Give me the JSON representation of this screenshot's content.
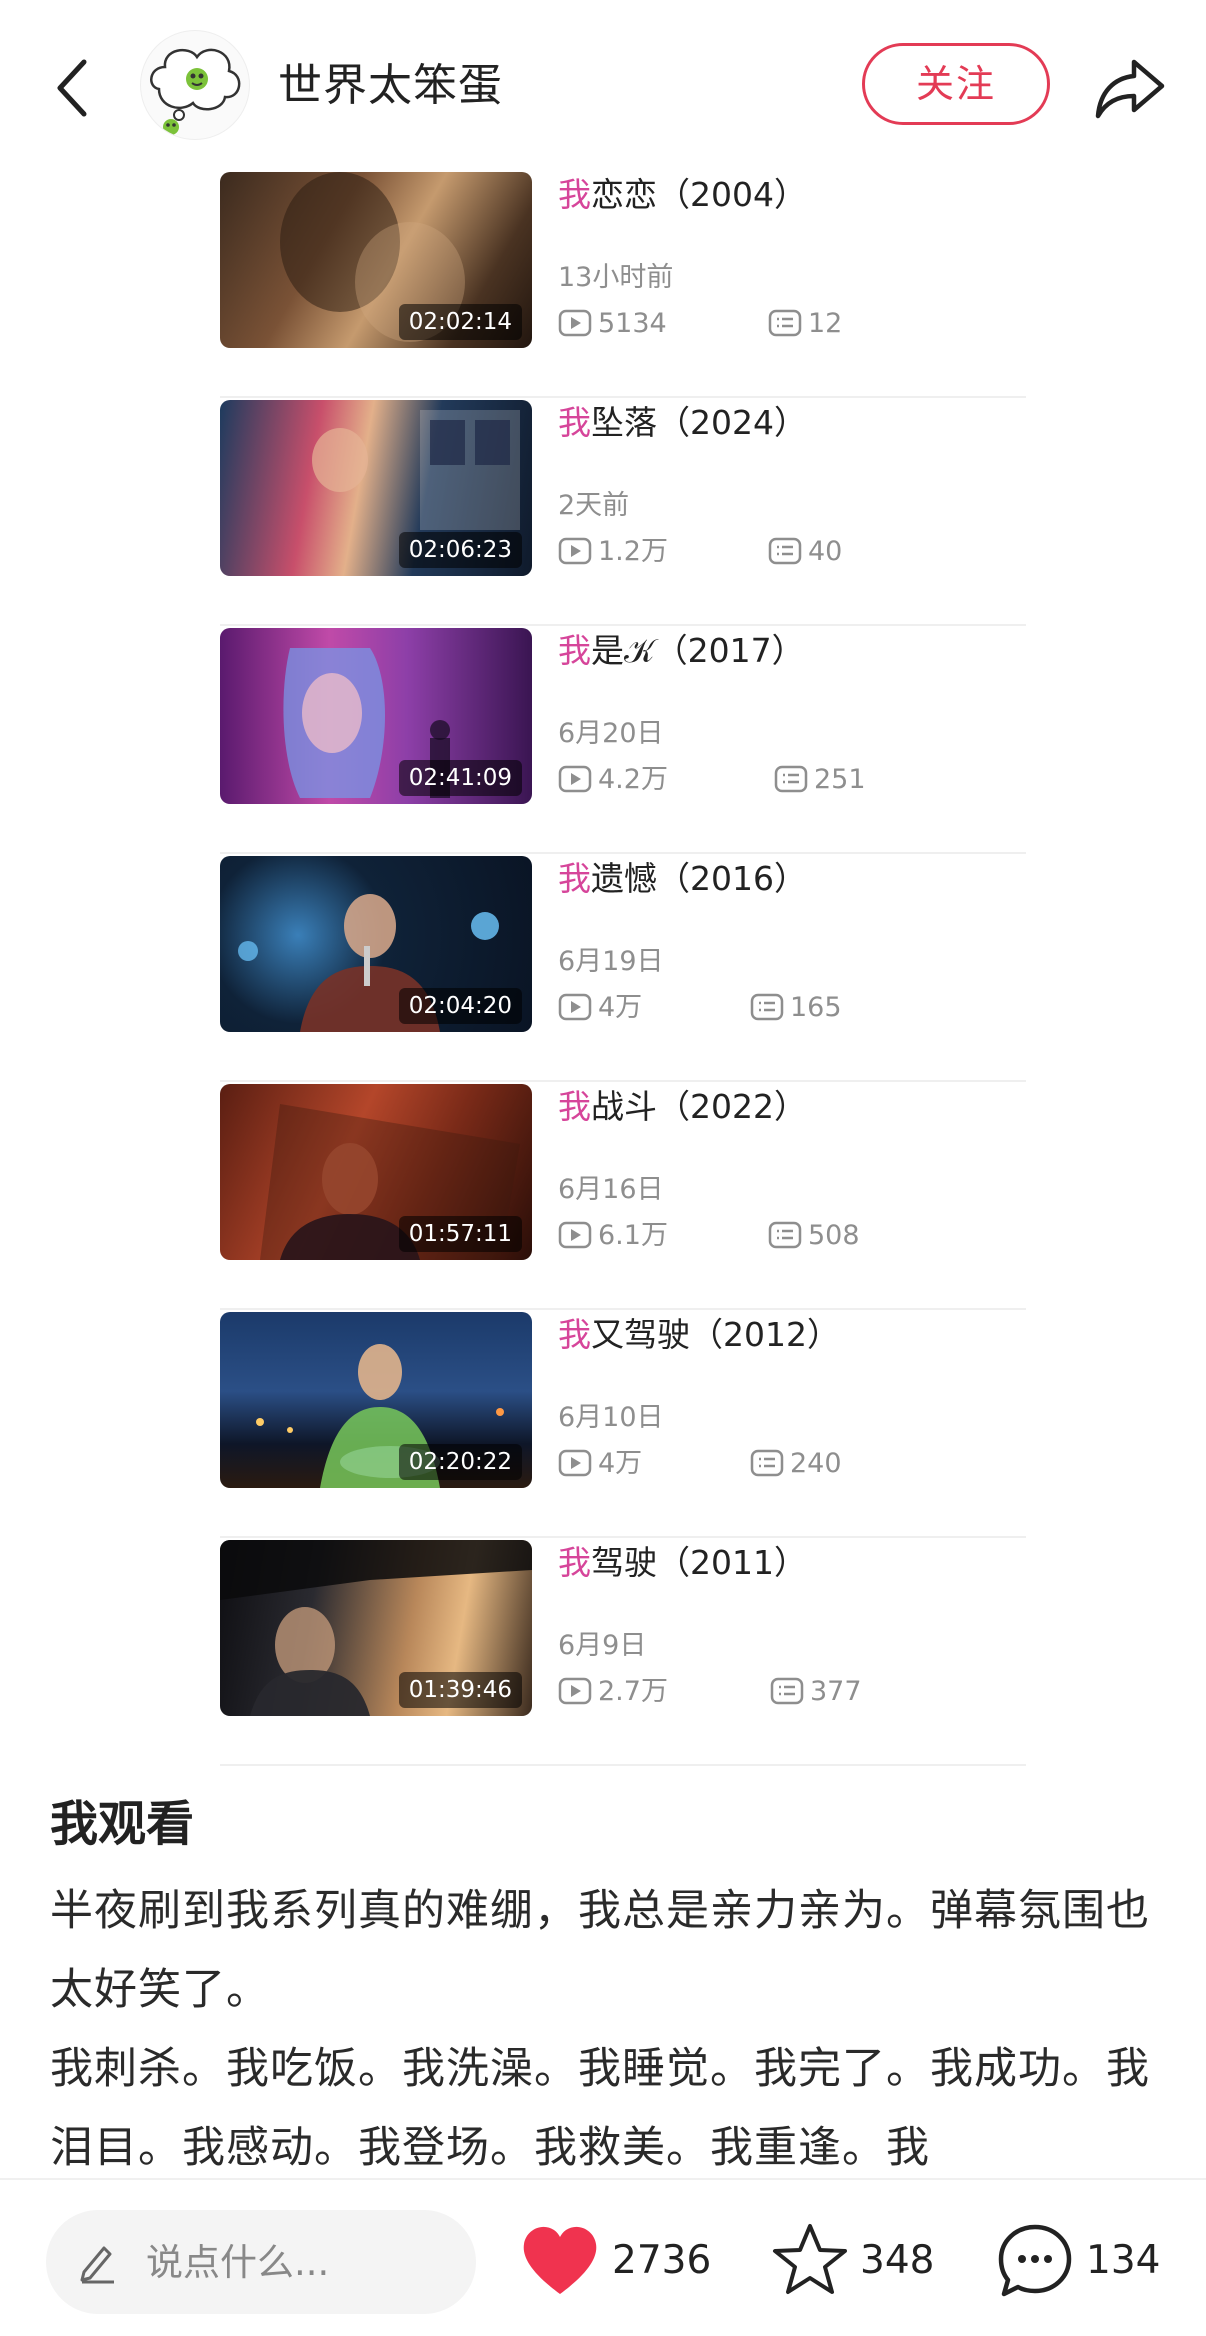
{
  "header": {
    "author_name": "世界太笨蛋",
    "follow_label": "关注"
  },
  "videos": [
    {
      "prefix": "我",
      "title": "恋恋（2004）",
      "duration": "02:02:14",
      "time": "13小时前",
      "views": "5134",
      "comments": "12"
    },
    {
      "prefix": "我",
      "title": "坠落（2024）",
      "duration": "02:06:23",
      "time": "2天前",
      "views": "1.2万",
      "comments": "40"
    },
    {
      "prefix": "我",
      "title": "是𝒦（2017）",
      "duration": "02:41:09",
      "time": "6月20日",
      "views": "4.2万",
      "comments": "251"
    },
    {
      "prefix": "我",
      "title": "遗憾（2016）",
      "duration": "02:04:20",
      "time": "6月19日",
      "views": "4万",
      "comments": "165"
    },
    {
      "prefix": "我",
      "title": "战斗（2022）",
      "duration": "01:57:11",
      "time": "6月16日",
      "views": "6.1万",
      "comments": "508"
    },
    {
      "prefix": "我",
      "title": "又驾驶（2012）",
      "duration": "02:20:22",
      "time": "6月10日",
      "views": "4万",
      "comments": "240"
    },
    {
      "prefix": "我",
      "title": "驾驶（2011）",
      "duration": "01:39:46",
      "time": "6月9日",
      "views": "2.7万",
      "comments": "377"
    }
  ],
  "post": {
    "title": "我观看",
    "body": "半夜刷到我系列真的难绷，我总是亲力亲为。弹幕氛围也太好笑了。\n我刺杀。我吃饭。我洗澡。我睡觉。我完了。我成功。我泪目。我感动。我登场。我救美。我重逢。我"
  },
  "bottom_bar": {
    "comment_placeholder": "说点什么...",
    "likes": "2736",
    "favorites": "348",
    "comments": "134"
  },
  "colors": {
    "accent_red": "#e33b55",
    "title_highlight": "#d6459a",
    "like_heart": "#f0334f"
  }
}
